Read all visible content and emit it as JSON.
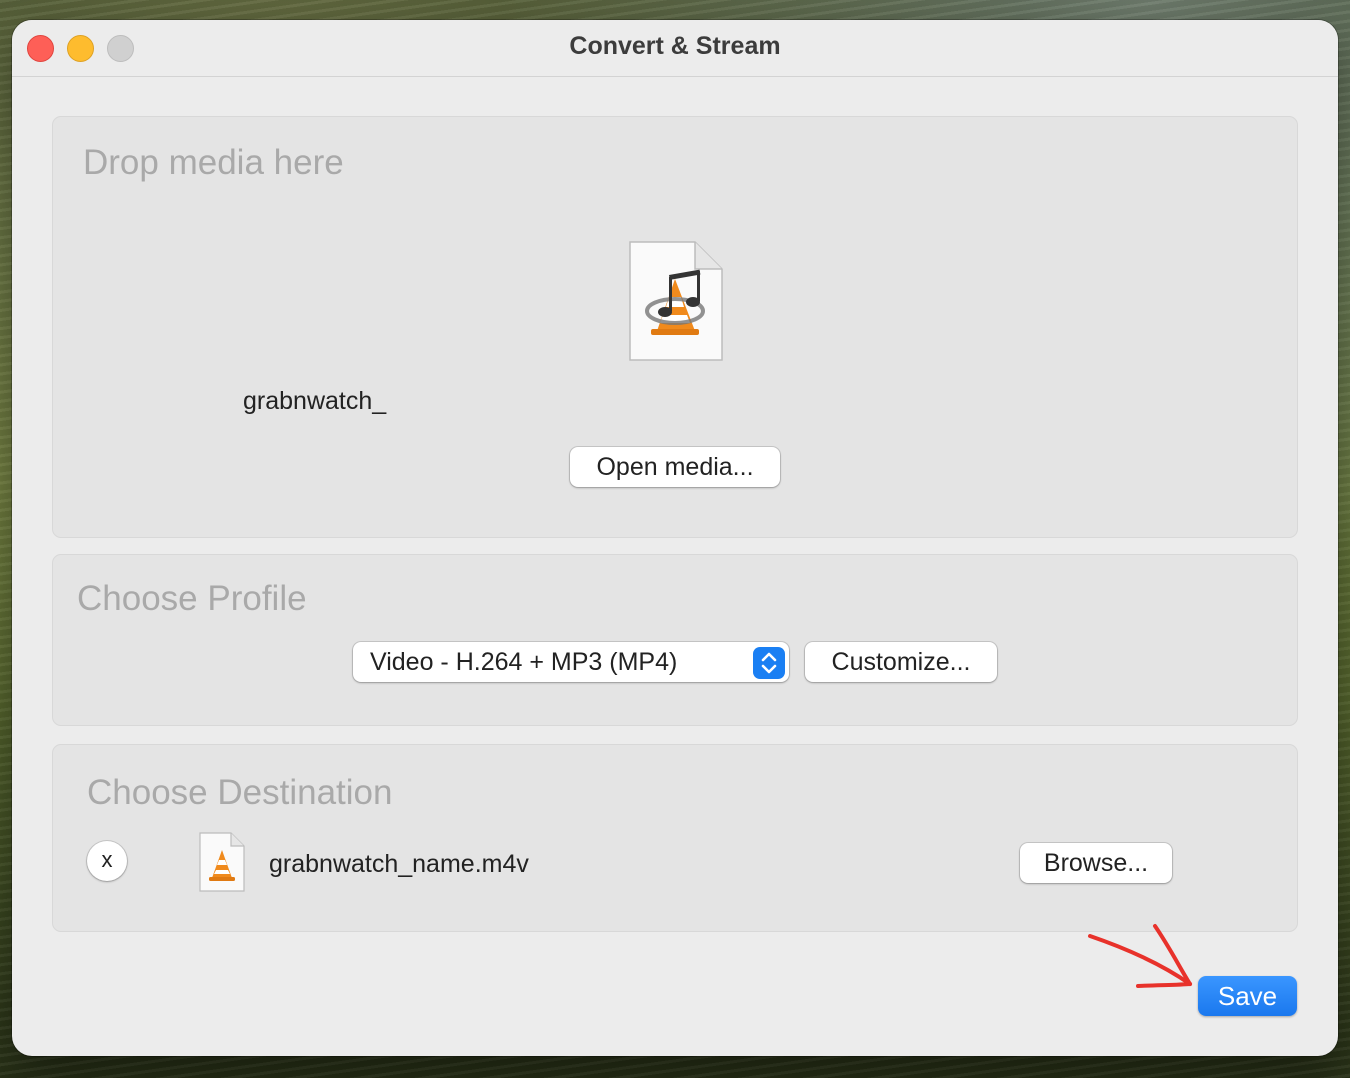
{
  "window": {
    "title": "Convert & Stream"
  },
  "source": {
    "heading": "Drop media here",
    "file_name": "grabnwatch_",
    "open_button": "Open media..."
  },
  "profile": {
    "heading": "Choose Profile",
    "selected": "Video - H.264 + MP3 (MP4)",
    "customize_button": "Customize..."
  },
  "destination": {
    "heading": "Choose Destination",
    "remove_button": "x",
    "file_name": "grabnwatch_name.m4v",
    "browse_button": "Browse..."
  },
  "footer": {
    "save_button": "Save"
  },
  "colors": {
    "accent": "#1a7ff3",
    "annotation_arrow": "#e8322b"
  },
  "icons": [
    "media-file-icon",
    "vlc-cone-icon",
    "music-note-icon",
    "stepper-icon",
    "vlc-file-icon"
  ]
}
